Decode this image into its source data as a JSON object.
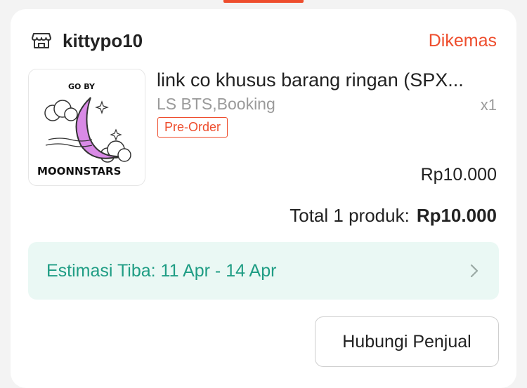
{
  "shop": {
    "name": "kittypo10",
    "status": "Dikemas"
  },
  "product": {
    "title": "link co khusus barang ringan (SPX...",
    "variant": "LS BTS,Booking",
    "quantity": "x1",
    "badge": "Pre-Order",
    "price": "Rp10.000",
    "image": {
      "top_text": "GO BY",
      "bottom_text": "MOONNSTARS"
    }
  },
  "summary": {
    "label": "Total 1 produk:",
    "amount": "Rp10.000"
  },
  "estimate": {
    "text": "Estimasi Tiba: 11 Apr - 14 Apr"
  },
  "actions": {
    "contact_seller": "Hubungi Penjual"
  },
  "colors": {
    "accent": "#ee4d2d",
    "estimate_bg": "#eaf8f4",
    "estimate_text": "#1f9d84"
  },
  "icons": {
    "shop": "store-icon",
    "chevron": "chevron-right-icon"
  }
}
